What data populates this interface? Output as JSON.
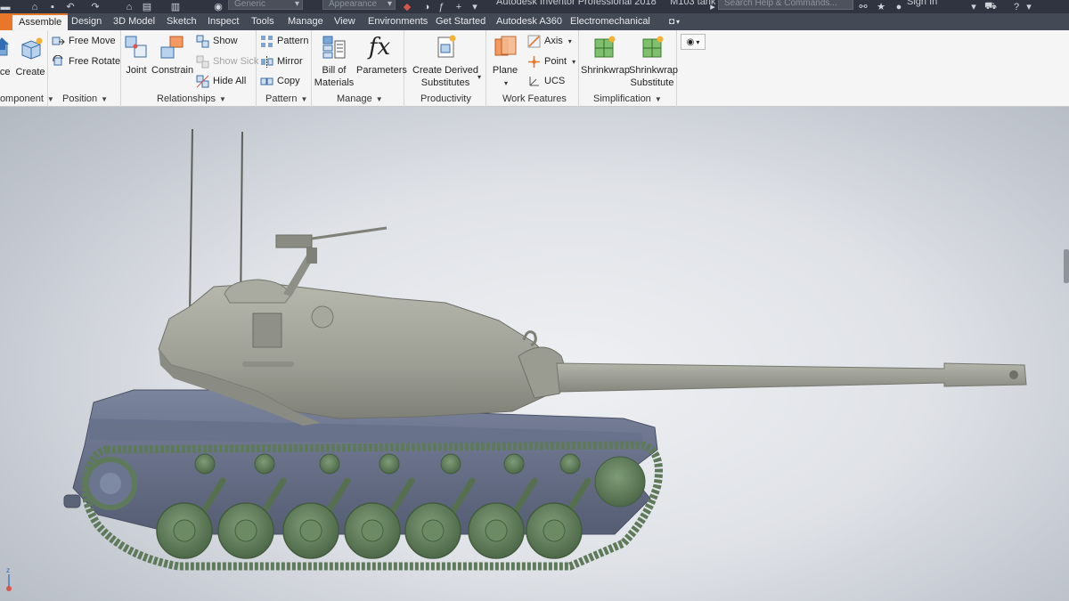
{
  "titlebar": {
    "app_title": "Autodesk Inventor Professional 2018",
    "document": "M103 tank",
    "material_dropdown": "Generic",
    "appearance_dropdown": "Appearance",
    "search_placeholder": "Search Help & Commands...",
    "sign_in": "Sign In"
  },
  "tabs": [
    {
      "label": "Assemble",
      "active": true
    },
    {
      "label": "Design"
    },
    {
      "label": "3D Model"
    },
    {
      "label": "Sketch"
    },
    {
      "label": "Inspect"
    },
    {
      "label": "Tools"
    },
    {
      "label": "Manage"
    },
    {
      "label": "View"
    },
    {
      "label": "Environments"
    },
    {
      "label": "Get Started"
    },
    {
      "label": "Autodesk A360"
    },
    {
      "label": "Electromechanical"
    }
  ],
  "ribbon": {
    "component": {
      "label": "Component",
      "place": "Place",
      "create": "Create"
    },
    "position": {
      "label": "Position",
      "free_move": "Free Move",
      "free_rotate": "Free Rotate"
    },
    "relationships": {
      "label": "Relationships",
      "joint": "Joint",
      "constrain": "Constrain",
      "show": "Show",
      "show_sick": "Show Sick",
      "hide_all": "Hide All"
    },
    "pattern": {
      "label": "Pattern",
      "pattern": "Pattern",
      "mirror": "Mirror",
      "copy": "Copy"
    },
    "manage": {
      "label": "Manage",
      "bom_line1": "Bill of",
      "bom_line2": "Materials",
      "parameters": "Parameters"
    },
    "productivity": {
      "label": "Productivity",
      "derived_line1": "Create Derived",
      "derived_line2": "Substitutes"
    },
    "work_features": {
      "label": "Work Features",
      "plane": "Plane",
      "axis": "Axis",
      "point": "Point",
      "ucs": "UCS"
    },
    "simplification": {
      "label": "Simplification",
      "shrinkwrap": "Shrinkwrap",
      "sw_sub_line1": "Shrinkwrap",
      "sw_sub_line2": "Substitute"
    }
  },
  "colors": {
    "accent": "#e8772b",
    "tab_bar": "#434955",
    "title_bar": "#2f3440",
    "hull": "#6b7590",
    "turret": "#a4a59c",
    "running_gear": "#5f7a5a"
  },
  "viewport": {
    "model": "M103 tank",
    "triad_axis": "z"
  }
}
